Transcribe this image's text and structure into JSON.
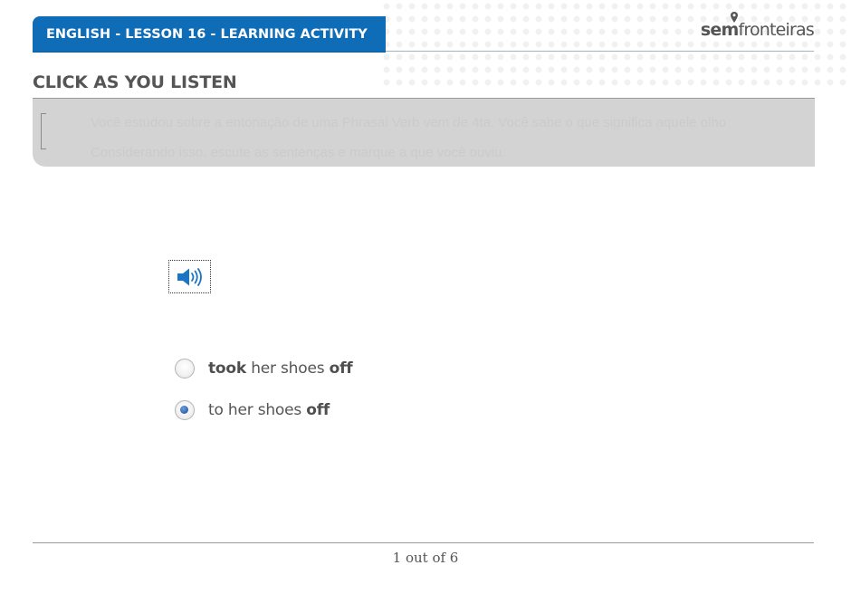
{
  "header": {
    "lesson_title": "ENGLISH - LESSON 16 - LEARNING ACTIVITY",
    "logo_prefix": "sem",
    "logo_suffix": "fronteiras",
    "brand_color": "#0f6cb6"
  },
  "activity": {
    "title": "CLICK AS YOU LISTEN",
    "instruction_line1": "Você estudou sobre a entonação de uma Phrasal Verb vem de 4ta. Você sabe o que significa aquele olho",
    "instruction_line2": "Considerando isso, escute as sentenças e marque a que você ouviu.",
    "audio_icon": "speaker-icon"
  },
  "options": [
    {
      "label_bold_start": "took",
      "label_middle": " her shoes ",
      "label_bold_end": "off",
      "checked": false
    },
    {
      "label_plain_start": "to her shoes ",
      "label_bold_end": "off",
      "checked": true
    }
  ],
  "footer": {
    "pagination": "1 out of 6"
  }
}
